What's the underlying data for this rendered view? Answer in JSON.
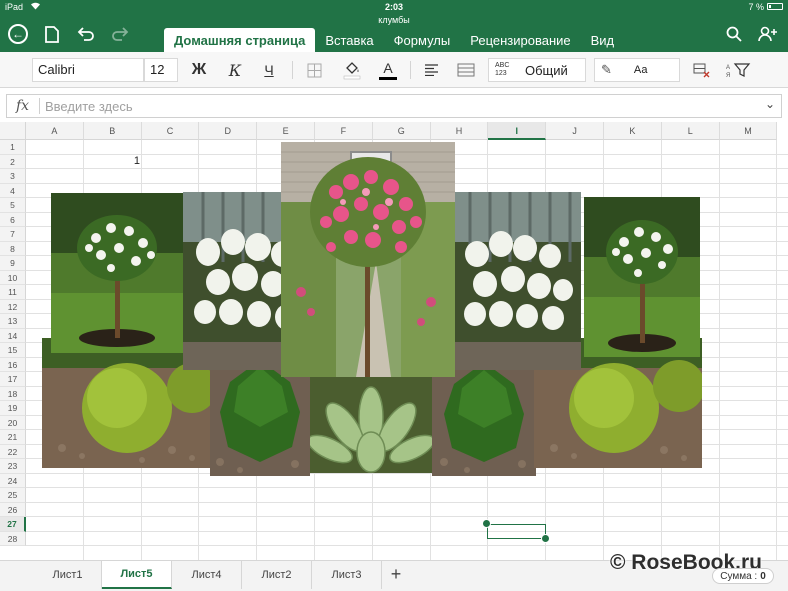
{
  "status_bar": {
    "carrier": "iPad",
    "wifi_icon": "wifi-icon",
    "time": "2:03",
    "battery": "7 %"
  },
  "document": {
    "title": "клумбы"
  },
  "header": {
    "tabs": [
      {
        "label": "Домашняя страница",
        "active": true
      },
      {
        "label": "Вставка",
        "active": false
      },
      {
        "label": "Формулы",
        "active": false
      },
      {
        "label": "Рецензирование",
        "active": false
      },
      {
        "label": "Вид",
        "active": false
      }
    ],
    "icons": [
      "back-icon",
      "file-icon",
      "undo-icon",
      "redo-icon",
      "search-icon",
      "share-icon"
    ]
  },
  "ribbon": {
    "font_name": "Calibri",
    "font_size": "12",
    "bold_label": "Ж",
    "italic_label": "К",
    "underline_label": "Ч",
    "number_format_icon_line1": "ABC",
    "number_format_icon_line2": "123",
    "number_format": "Общий",
    "cell_styles_label": "Аа",
    "colors": {
      "font_color": "#000000",
      "fill_color": "#ffffff",
      "accent": "#217346"
    }
  },
  "formula_bar": {
    "fx_label": "fx",
    "placeholder": "Введите здесь",
    "value": ""
  },
  "grid": {
    "columns": [
      "A",
      "B",
      "C",
      "D",
      "E",
      "F",
      "G",
      "H",
      "I",
      "J",
      "K",
      "L",
      "M"
    ],
    "rows": [
      "1",
      "2",
      "3",
      "4",
      "5",
      "6",
      "7",
      "8",
      "9",
      "10",
      "11",
      "12",
      "13",
      "14",
      "15",
      "16",
      "17",
      "18",
      "19",
      "20",
      "21",
      "22",
      "23",
      "24",
      "25",
      "26",
      "27",
      "28"
    ],
    "selected_column": "I",
    "selected_row": "27",
    "selected_cell": "I27",
    "cells": [
      {
        "ref": "B2",
        "value": "1"
      }
    ]
  },
  "images": [
    {
      "name": "white-rose-standard-tree-photo",
      "subject": "white standard rose tree"
    },
    {
      "name": "white-hydrangea-photo",
      "subject": "white hydrangea bush"
    },
    {
      "name": "pink-rose-standard-tree-photo",
      "subject": "pink standard rose tree by house"
    },
    {
      "name": "white-hydrangea-photo-right",
      "subject": "white hydrangea bush"
    },
    {
      "name": "white-rose-standard-tree-photo-right",
      "subject": "white standard rose tree"
    },
    {
      "name": "round-thuja-photo",
      "subject": "round thuja"
    },
    {
      "name": "dwarf-conifer-photo",
      "subject": "dwarf conifer"
    },
    {
      "name": "hosta-photo",
      "subject": "hosta"
    },
    {
      "name": "dwarf-conifer-photo-right",
      "subject": "dwarf conifer"
    },
    {
      "name": "round-thuja-photo-right",
      "subject": "round thuja"
    }
  ],
  "sheets": [
    {
      "label": "Лист1",
      "active": false
    },
    {
      "label": "Лист5",
      "active": true
    },
    {
      "label": "Лист4",
      "active": false
    },
    {
      "label": "Лист2",
      "active": false
    },
    {
      "label": "Лист3",
      "active": false
    }
  ],
  "status": {
    "sum_label": "Сумма :",
    "sum_value": "0"
  },
  "watermark": "© RoseBook.ru"
}
